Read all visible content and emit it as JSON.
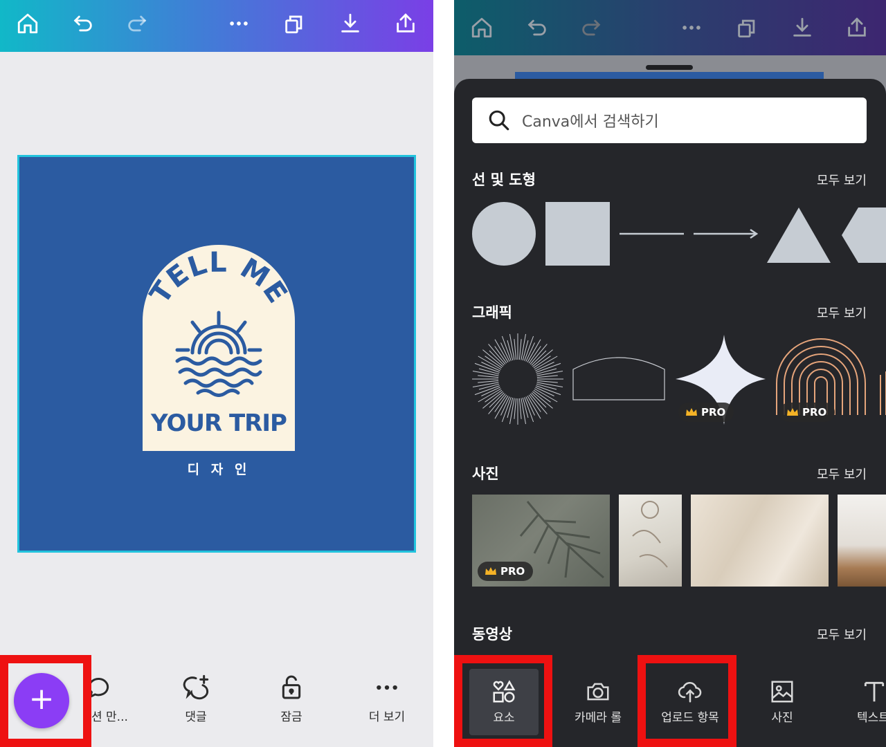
{
  "left_screen": {
    "design": {
      "badge_top_text": "TELL ME",
      "badge_bottom_text": "YOUR TRIP",
      "caption": "디 자 인",
      "colors": {
        "background": "#2b5ba1",
        "badge": "#fbf3e1",
        "selection": "#22c3dd"
      }
    },
    "bottom_bar": {
      "add_label": "+",
      "items": [
        {
          "label": "션 만...",
          "icon": "speech-bubble-icon"
        },
        {
          "label": "댓글",
          "icon": "comment-add-icon"
        },
        {
          "label": "잠금",
          "icon": "lock-icon"
        },
        {
          "label": "더 보기",
          "icon": "more-dots-icon"
        }
      ]
    }
  },
  "right_screen": {
    "search": {
      "placeholder": "Canva에서 검색하기"
    },
    "sections": [
      {
        "title": "선 및 도형",
        "more": "모두 보기"
      },
      {
        "title": "그래픽",
        "more": "모두 보기"
      },
      {
        "title": "사진",
        "more": "모두 보기"
      },
      {
        "title": "동영상",
        "more": "모두 보기"
      }
    ],
    "pro_label": "PRO",
    "nav": [
      {
        "label": "요소",
        "icon": "elements-icon"
      },
      {
        "label": "카메라 롤",
        "icon": "camera-icon"
      },
      {
        "label": "업로드 항목",
        "icon": "cloud-upload-icon"
      },
      {
        "label": "사진",
        "icon": "image-icon"
      },
      {
        "label": "텍스트",
        "icon": "text-icon"
      }
    ]
  },
  "colors": {
    "highlight": "#ee1111",
    "accent_purple": "#8b3df5",
    "panel": "#25262a"
  }
}
